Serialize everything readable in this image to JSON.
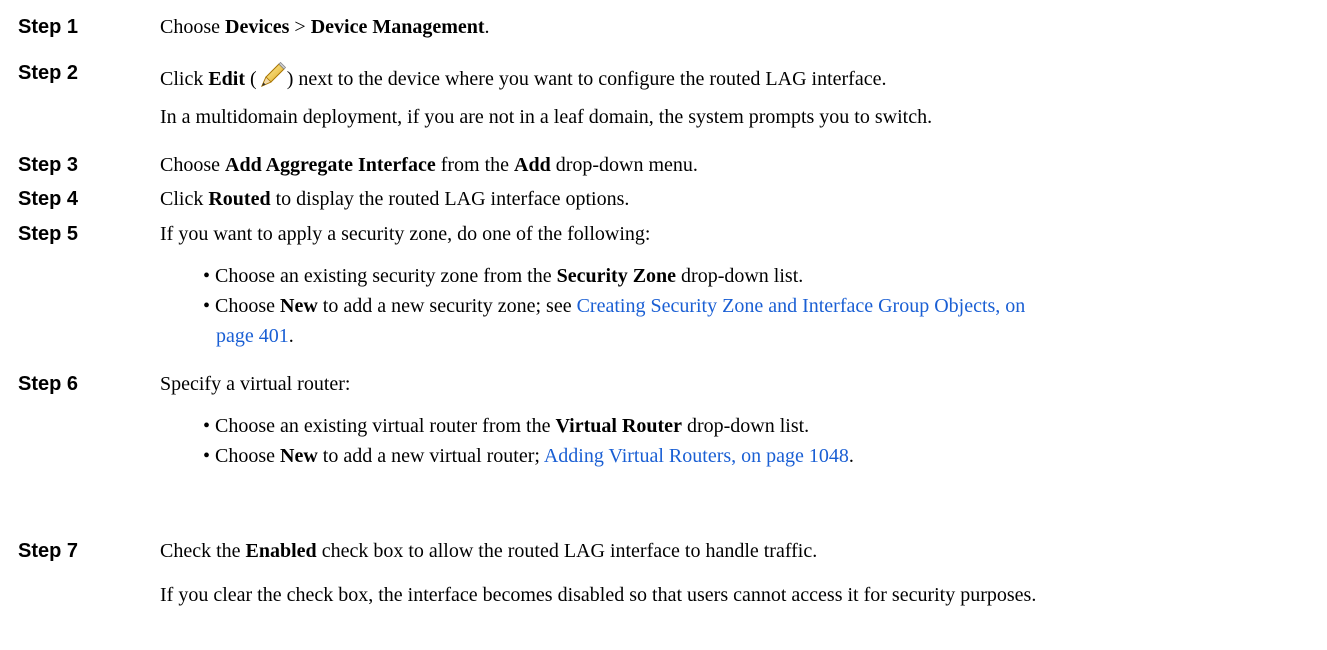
{
  "steps": [
    {
      "label": "Step 1",
      "lines": [
        {
          "t1": "Choose ",
          "b1": "Devices",
          "t2": " > ",
          "b2": "Device Management",
          "t3": "."
        }
      ]
    },
    {
      "label": "Step 2",
      "lines": [
        {
          "t1": "Click ",
          "b1": "Edit",
          "t2": " (",
          "t3": ") next to the device where you want to configure the routed LAG interface."
        },
        {
          "t1": "In a multidomain deployment, if you are not in a leaf domain, the system prompts you to switch."
        }
      ]
    },
    {
      "label": "Step 3",
      "lines": [
        {
          "t1": "Choose ",
          "b1": "Add Aggregate Interface",
          "t2": " from the ",
          "b2": "Add",
          "t3": " drop-down menu."
        }
      ]
    },
    {
      "label": "Step 4",
      "lines": [
        {
          "t1": "Click ",
          "b1": "Routed",
          "t2": " to display the routed LAG interface options."
        }
      ]
    },
    {
      "label": "Step 5",
      "lines": [
        {
          "t1": "If you want to apply a security zone, do one of the following:"
        }
      ],
      "bullets": [
        {
          "t1": "• Choose an existing security zone from the ",
          "b1": "Security Zone",
          "t2": " drop-down list."
        },
        {
          "t1": "• Choose ",
          "b1": "New",
          "t2": " to add a new security zone; see ",
          "link1": "Creating Security Zone and Interface Group Objects, on",
          "link2": "page 401",
          "t3": "."
        }
      ]
    },
    {
      "label": "Step 6",
      "lines": [
        {
          "t1": "Specify a virtual router:"
        }
      ],
      "bullets": [
        {
          "t1": "• Choose an existing virtual router from the ",
          "b1": "Virtual Router",
          "t2": " drop-down list."
        },
        {
          "t1": "• Choose ",
          "b1": "New",
          "t2": " to add a new virtual router; ",
          "link1": "Adding Virtual Routers, on page 1048",
          "t3": "."
        }
      ]
    },
    {
      "label": "Step 7",
      "lines": [
        {
          "t1": "Check the ",
          "b1": "Enabled",
          "t2": " check box to allow the routed LAG interface to handle traffic."
        },
        {
          "t1": "If you clear the check box, the interface becomes disabled so that users cannot access it for security purposes."
        }
      ]
    }
  ],
  "icons": {
    "edit": "pencil-icon"
  },
  "colors": {
    "link": "#1a5fd4"
  }
}
